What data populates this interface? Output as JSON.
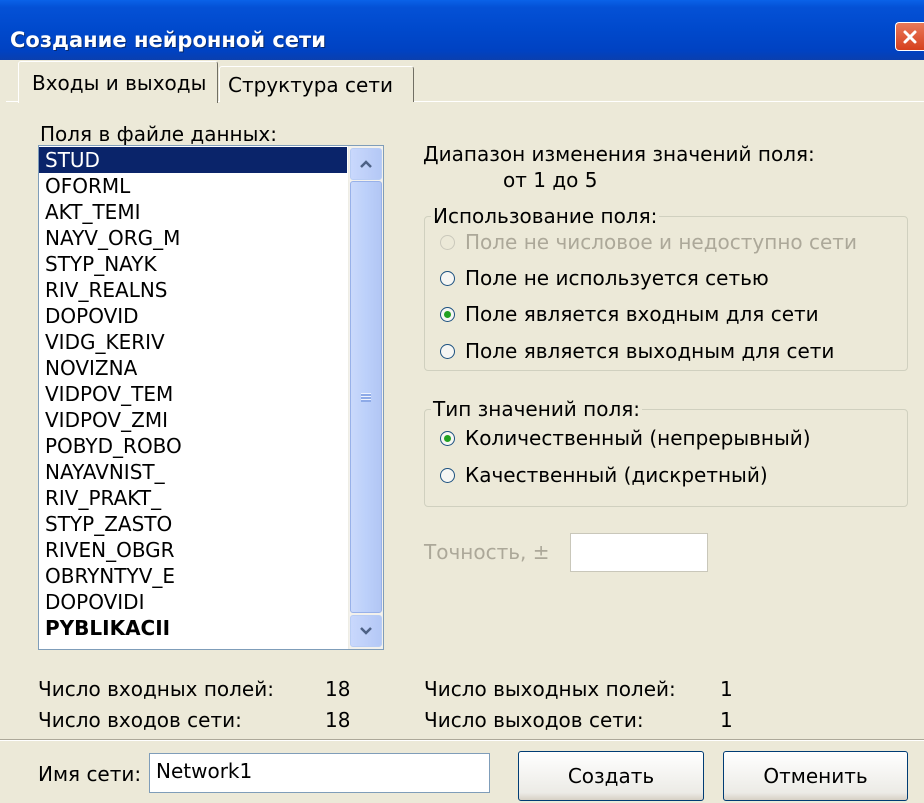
{
  "window": {
    "title": "Создание нейронной сети"
  },
  "tabs": [
    {
      "label": "Входы и выходы",
      "active": true
    },
    {
      "label": "Структура сети",
      "active": false
    }
  ],
  "fields_panel": {
    "label": "Поля в файле данных:",
    "items": [
      "STUD",
      "OFORML",
      "AKT_TEMI",
      "NAYV_ORG_M",
      "STYP_NAYK",
      "RIV_REALNS",
      "DOPOVID",
      "VIDG_KERIV",
      "NOVIZNA",
      "VIDPOV_TEM",
      "VIDPOV_ZMI",
      "POBYD_ROBO",
      "NAYAVNIST_",
      "RIV_PRAKT_",
      "STYP_ZASTO",
      "RIVEN_OBGR",
      "OBRYNTYV_E",
      "DOPOVIDI",
      "PYBLIKACII"
    ],
    "selected_index": 0
  },
  "range": {
    "label": "Диапазон изменения значений поля:",
    "value": "от 1 до 5"
  },
  "usage_group": {
    "title": "Использование поля:",
    "options": [
      {
        "label": "Поле не числовое и недоступно сети",
        "checked": false,
        "disabled": true
      },
      {
        "label": "Поле не используется сетью",
        "checked": false,
        "disabled": false
      },
      {
        "label": "Поле является входным для сети",
        "checked": true,
        "disabled": false
      },
      {
        "label": "Поле является выходным для сети",
        "checked": false,
        "disabled": false
      }
    ]
  },
  "type_group": {
    "title": "Тип значений поля:",
    "options": [
      {
        "label": "Количественный (непрерывный)",
        "checked": true
      },
      {
        "label": "Качественный (дискретный)",
        "checked": false
      }
    ]
  },
  "precision": {
    "label": "Точность, ±",
    "value": ""
  },
  "stats": {
    "input_fields_label": "Число входных полей:",
    "input_fields_value": "18",
    "network_inputs_label": "Число входов сети:",
    "network_inputs_value": "18",
    "output_fields_label": "Число выходных полей:",
    "output_fields_value": "1",
    "network_outputs_label": "Число выходов сети:",
    "network_outputs_value": "1"
  },
  "footer": {
    "name_label": "Имя сети:",
    "name_value": "Network1",
    "create_label": "Создать",
    "cancel_label": "Отменить"
  },
  "icons": {
    "close": "close-x-icon",
    "scroll_up": "chevron-up-icon",
    "scroll_down": "chevron-down-icon",
    "scroll_grip": "grip-icon"
  },
  "colors": {
    "titlebar": "#0049cc",
    "selection": "#0a246a",
    "close_button": "#d6401d",
    "radio_checked": "#21a121",
    "dialog_background": "#ece9d8"
  }
}
